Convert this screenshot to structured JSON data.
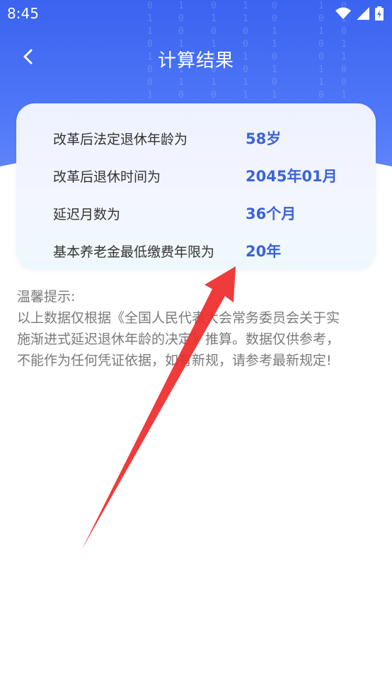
{
  "status_bar": {
    "time": "8:45"
  },
  "nav": {
    "title": "计算结果"
  },
  "results": [
    {
      "label": "改革后法定退休年龄为",
      "value": "58岁"
    },
    {
      "label": "改革后退休时间为",
      "value": "2045年01月"
    },
    {
      "label": "延迟月数为",
      "value": "36个月"
    },
    {
      "label": "基本养老金最低缴费年限为",
      "value": "20年"
    }
  ],
  "tips": {
    "title": "温馨提示:",
    "lines": [
      "以上数据仅根据《全国人民代表大会常务委员会关于实",
      "施渐进式延迟退休年龄的决定》推算。数据仅供参考，",
      "不能作为任何凭证依据，如有新规，请参考最新规定!"
    ]
  },
  "colors": {
    "header": "#4a73f6",
    "value": "#3b63d8",
    "arrow": "#ee2a2a"
  }
}
